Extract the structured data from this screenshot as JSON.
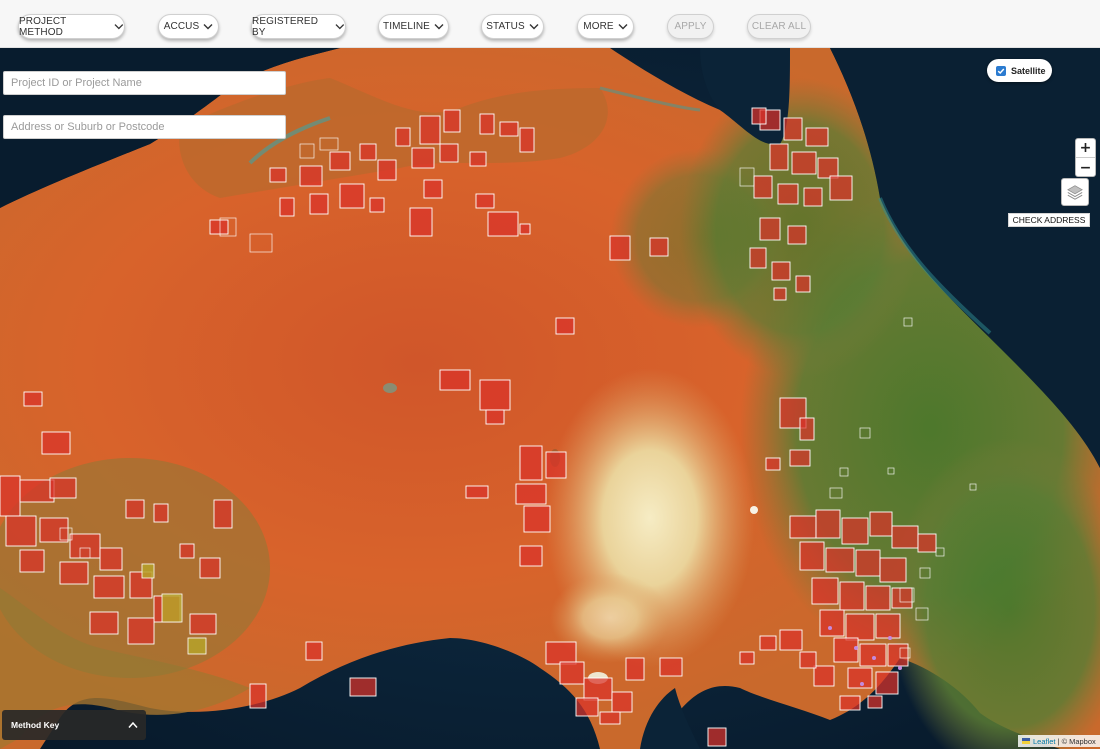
{
  "filters": [
    {
      "label": "PROJECT METHOD",
      "chevron": true,
      "enabled": true
    },
    {
      "label": "ACCUS",
      "chevron": true,
      "enabled": true
    },
    {
      "label": "REGISTERED BY",
      "chevron": true,
      "enabled": true
    },
    {
      "label": "TIMELINE",
      "chevron": true,
      "enabled": true
    },
    {
      "label": "STATUS",
      "chevron": true,
      "enabled": true
    },
    {
      "label": "MORE",
      "chevron": true,
      "enabled": true
    },
    {
      "label": "APPLY",
      "chevron": false,
      "enabled": false
    },
    {
      "label": "CLEAR ALL",
      "chevron": false,
      "enabled": false
    }
  ],
  "search": {
    "project_placeholder": "Project ID or Project Name",
    "address_placeholder": "Address or Suburb or Postcode"
  },
  "map_controls": {
    "satellite_label": "Satellite",
    "satellite_checked": true,
    "zoom_in": "+",
    "zoom_out": "−",
    "check_address_label": "CHECK ADDRESS",
    "method_key_label": "Method Key"
  },
  "attribution": {
    "leaflet": "Leaflet",
    "separator": "| ©",
    "mapbox": "Mapbox"
  },
  "colors": {
    "ocean": "#0c2538",
    "desert_red": "#d75a25",
    "desert_orange": "#e6782e",
    "forest_green": "#4f7a31",
    "salt_lake": "#eadcb2",
    "project_fill": "#d9322a",
    "project_outline": "#ffffff",
    "checkbox_blue": "#2b7bd0",
    "leaflet_link": "#0078a8"
  },
  "icons": {
    "filter_chevron": "chevron-down-icon",
    "layers": "layers-icon",
    "method_key_toggle": "chevron-up-icon",
    "satellite_checkbox": "checkmark-icon"
  }
}
